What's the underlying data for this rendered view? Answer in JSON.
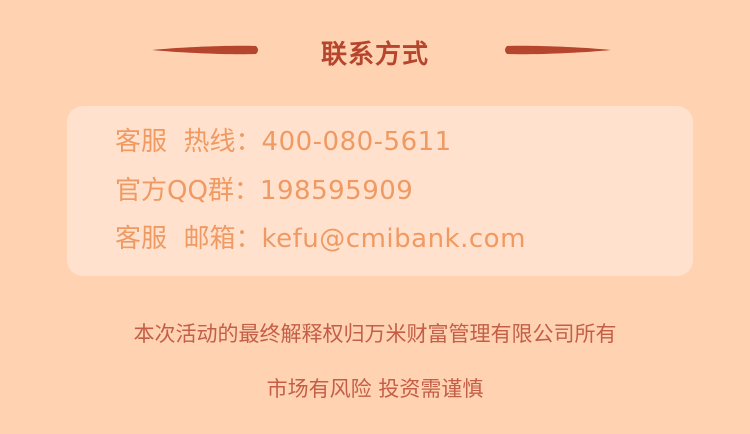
{
  "header": {
    "title": "联系方式"
  },
  "contact": {
    "rows": [
      {
        "label": "客服  热线：",
        "value": "400-080-5611"
      },
      {
        "label": "官方QQ群：",
        "value": "198595909"
      },
      {
        "label": "客服  邮箱：",
        "value": "kefu@cmibank.com"
      }
    ]
  },
  "footer": {
    "disclaimer": "本次活动的最终解释权归万米财富管理有限公司所有",
    "risk_warning": "市场有风险 投资需谨慎"
  },
  "colors": {
    "background": "#ffd3b2",
    "card": "#ffe1cd",
    "title": "#b5452c",
    "text": "#f09a63",
    "footer_text": "#c45e47"
  }
}
